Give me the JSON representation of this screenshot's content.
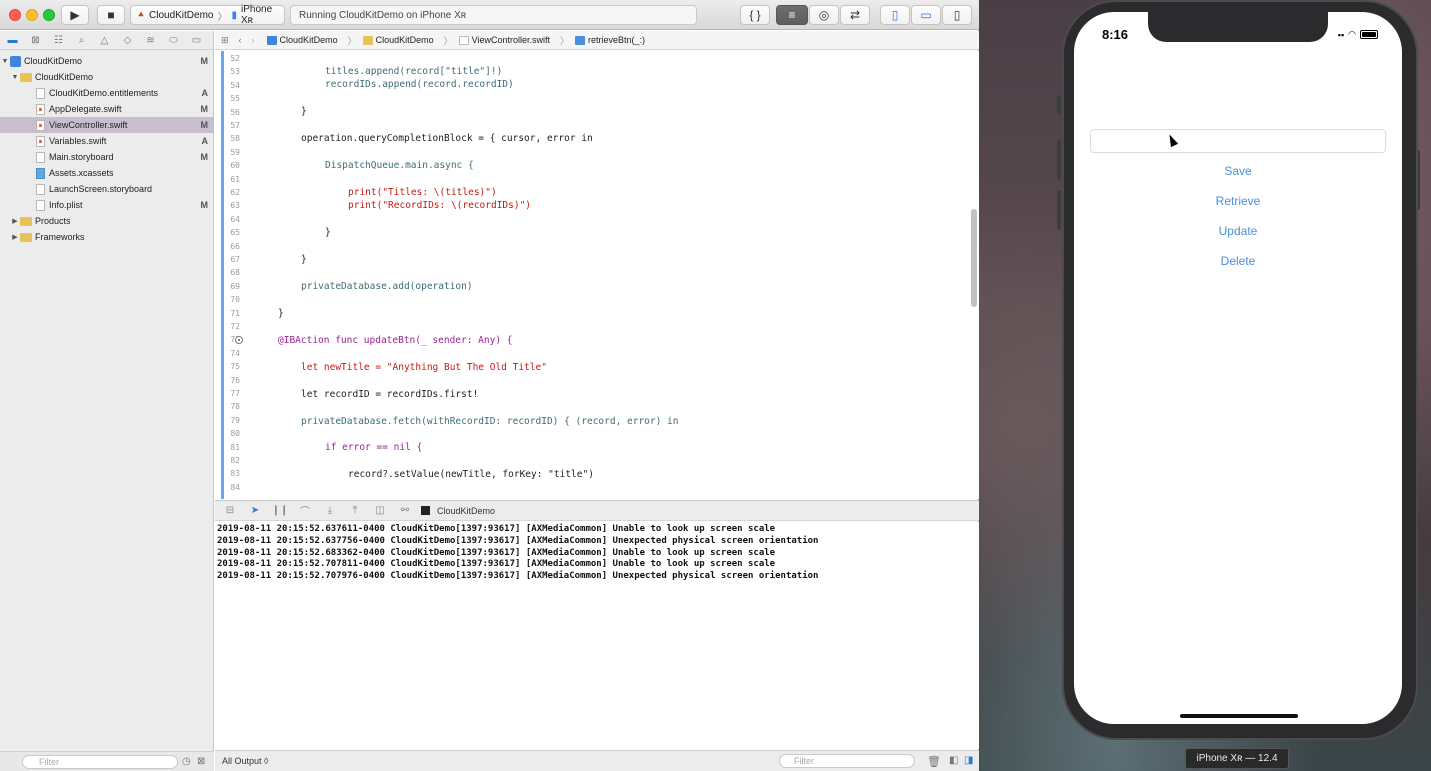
{
  "toolbar": {
    "scheme_app": "CloudKitDemo",
    "scheme_device": "iPhone Xʀ",
    "activity_status": "Running CloudKitDemo on iPhone Xʀ"
  },
  "navigator": {
    "rows": [
      {
        "label": "CloudKitDemo",
        "badge": "M"
      },
      {
        "label": "CloudKitDemo",
        "badge": ""
      },
      {
        "label": "CloudKitDemo.entitlements",
        "badge": "A"
      },
      {
        "label": "AppDelegate.swift",
        "badge": "M"
      },
      {
        "label": "ViewController.swift",
        "badge": "M"
      },
      {
        "label": "Variables.swift",
        "badge": "A"
      },
      {
        "label": "Main.storyboard",
        "badge": "M"
      },
      {
        "label": "Assets.xcassets",
        "badge": ""
      },
      {
        "label": "LaunchScreen.storyboard",
        "badge": ""
      },
      {
        "label": "Info.plist",
        "badge": "M"
      },
      {
        "label": "Products",
        "badge": ""
      },
      {
        "label": "Frameworks",
        "badge": ""
      }
    ],
    "filter_placeholder": "Filter"
  },
  "jumpbar": {
    "project": "CloudKitDemo",
    "group": "CloudKitDemo",
    "file": "ViewController.swift",
    "symbol": "retrieveBtn(_:)"
  },
  "editor": {
    "line_numbers": [
      "52",
      "53",
      "54",
      "55",
      "56",
      "57",
      "58",
      "59",
      "60",
      "61",
      "62",
      "63",
      "64",
      "65",
      "66",
      "67",
      "68",
      "69",
      "70",
      "71",
      "72",
      "73",
      "74",
      "75",
      "76",
      "77",
      "78",
      "79",
      "80",
      "81",
      "82",
      "83",
      "84"
    ],
    "code": {
      "l53": "titles.append(record[\"title\"]!)",
      "l54": "recordIDs.append(record.recordID)",
      "l56": "}",
      "l58": "operation.queryCompletionBlock = { cursor, error in",
      "l60": "DispatchQueue.main.async {",
      "l62": "print(\"Titles: \\(titles)\")",
      "l63": "print(\"RecordIDs: \\(recordIDs)\")",
      "l65": "}",
      "l67": "}",
      "l69": "privateDatabase.add(operation)",
      "l71": "}",
      "l73": "@IBAction func updateBtn(_ sender: Any) {",
      "l75": "let newTitle = \"Anything But The Old Title\"",
      "l77": "let recordID = recordIDs.first!",
      "l79": "privateDatabase.fetch(withRecordID: recordID) { (record, error) in",
      "l81": "if error == nil {",
      "l83": "record?.setValue(newTitle, forKey: \"title\")"
    }
  },
  "debug": {
    "target": "CloudKitDemo"
  },
  "console": {
    "lines": [
      "2019-08-11 20:15:52.637611-0400 CloudKitDemo[1397:93617] [AXMediaCommon] Unable to look up screen scale",
      "2019-08-11 20:15:52.637756-0400 CloudKitDemo[1397:93617] [AXMediaCommon] Unexpected physical screen orientation",
      "2019-08-11 20:15:52.683362-0400 CloudKitDemo[1397:93617] [AXMediaCommon] Unable to look up screen scale",
      "2019-08-11 20:15:52.707811-0400 CloudKitDemo[1397:93617] [AXMediaCommon] Unable to look up screen scale",
      "2019-08-11 20:15:52.707976-0400 CloudKitDemo[1397:93617] [AXMediaCommon] Unexpected physical screen orientation"
    ],
    "output_selector": "All Output ◊",
    "filter_placeholder": "Filter"
  },
  "simulator": {
    "time": "8:16",
    "buttons": {
      "save": "Save",
      "retrieve": "Retrieve",
      "update": "Update",
      "delete": "Delete"
    },
    "device_label": "iPhone Xʀ — 12.4"
  },
  "colors": {
    "selection": "#c7bfd0",
    "link_blue": "#4a8fe0",
    "keyword": "#9b2393",
    "string": "#c41a16"
  }
}
